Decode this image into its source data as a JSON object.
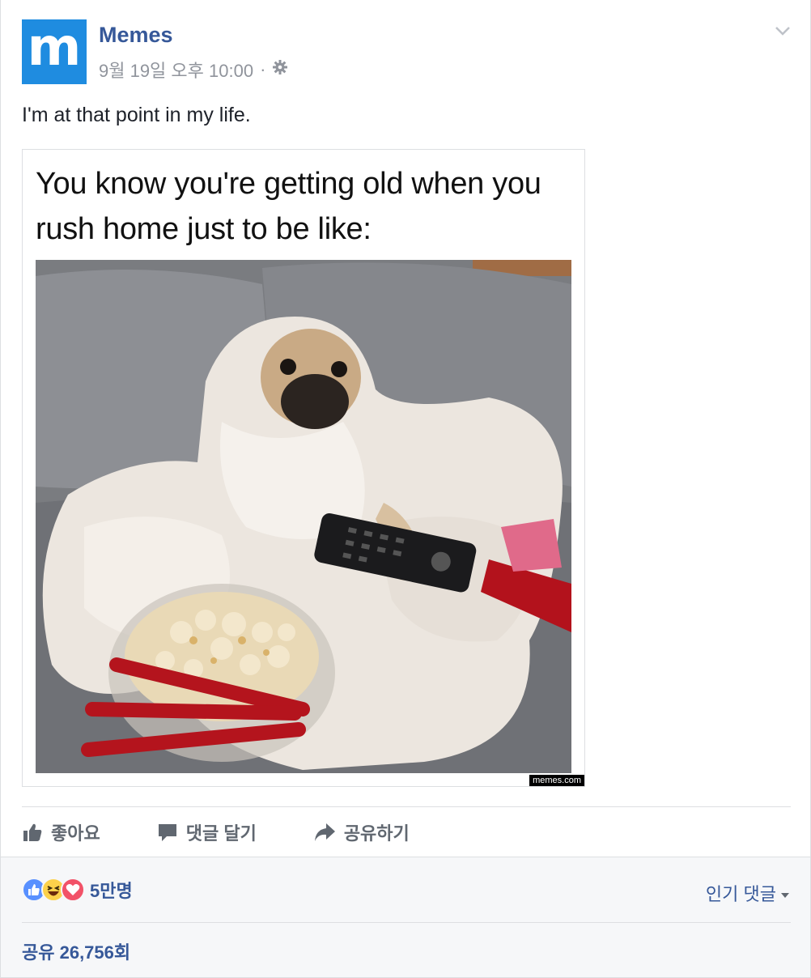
{
  "header": {
    "avatar_letter": "m",
    "page_name": "Memes",
    "timestamp": "9월 19일 오후 10:00",
    "separator": "·",
    "privacy_icon": "gear-icon",
    "menu_icon": "chevron-down-icon"
  },
  "post": {
    "text": "I'm at that point in my life."
  },
  "meme": {
    "caption": "You know you're getting old when you rush home just to be like:",
    "watermark": "memes.com"
  },
  "actions": {
    "like_label": "좋아요",
    "comment_label": "댓글 달기",
    "share_label": "공유하기"
  },
  "reactions": {
    "icons": [
      "like-icon",
      "haha-icon",
      "love-icon"
    ],
    "count": "5만명"
  },
  "comments": {
    "sort_label": "인기 댓글"
  },
  "shares": {
    "label": "공유 26,756회"
  },
  "colors": {
    "link_blue": "#365899",
    "avatar_blue": "#1f8ce0",
    "like_blue": "#5890ff",
    "love_red": "#f25268",
    "haha_yellow": "#fcd14b"
  }
}
